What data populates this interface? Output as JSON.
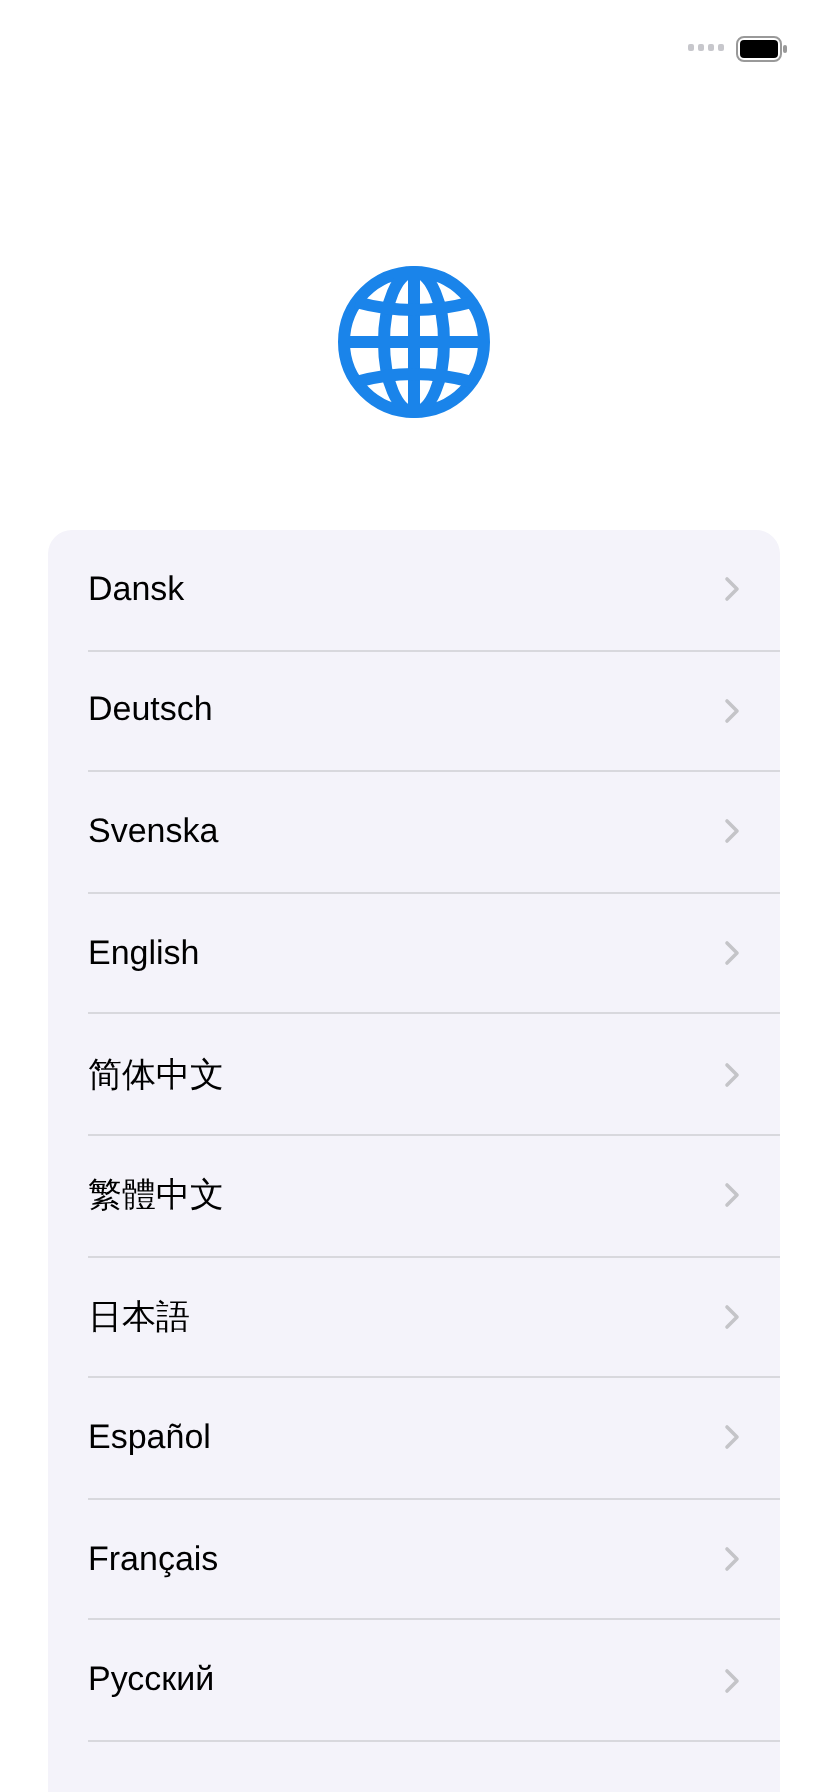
{
  "languages": [
    {
      "label": "Dansk"
    },
    {
      "label": "Deutsch"
    },
    {
      "label": "Svenska"
    },
    {
      "label": "English"
    },
    {
      "label": "简体中文"
    },
    {
      "label": "繁體中文"
    },
    {
      "label": "日本語"
    },
    {
      "label": "Español"
    },
    {
      "label": "Français"
    },
    {
      "label": "Русский"
    }
  ]
}
